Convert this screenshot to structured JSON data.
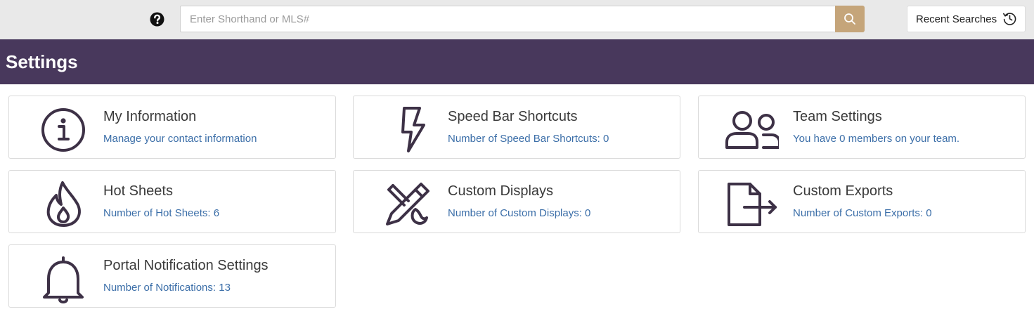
{
  "search": {
    "placeholder": "Enter Shorthand or MLS#",
    "recent_label": "Recent Searches"
  },
  "page": {
    "title": "Settings"
  },
  "cards": [
    {
      "title": "My Information",
      "desc": "Manage your contact information",
      "icon": "info-circle-icon"
    },
    {
      "title": "Speed Bar Shortcuts",
      "desc": "Number of Speed Bar Shortcuts: 0",
      "icon": "lightning-bolt-icon"
    },
    {
      "title": "Team Settings",
      "desc": "You have 0 members on your team.",
      "icon": "users-icon"
    },
    {
      "title": "Hot Sheets",
      "desc": "Number of Hot Sheets: 6",
      "icon": "flame-icon"
    },
    {
      "title": "Custom Displays",
      "desc": "Number of Custom Displays: 0",
      "icon": "pencil-brush-icon"
    },
    {
      "title": "Custom Exports",
      "desc": "Number of Custom Exports: 0",
      "icon": "file-export-icon"
    },
    {
      "title": "Portal Notification Settings",
      "desc": "Number of Notifications: 13",
      "icon": "bell-icon"
    }
  ],
  "colors": {
    "header_bg": "#48385c",
    "search_button": "#c5a57a",
    "link_text": "#3b6ea8",
    "icon_stroke": "#3d3146"
  }
}
